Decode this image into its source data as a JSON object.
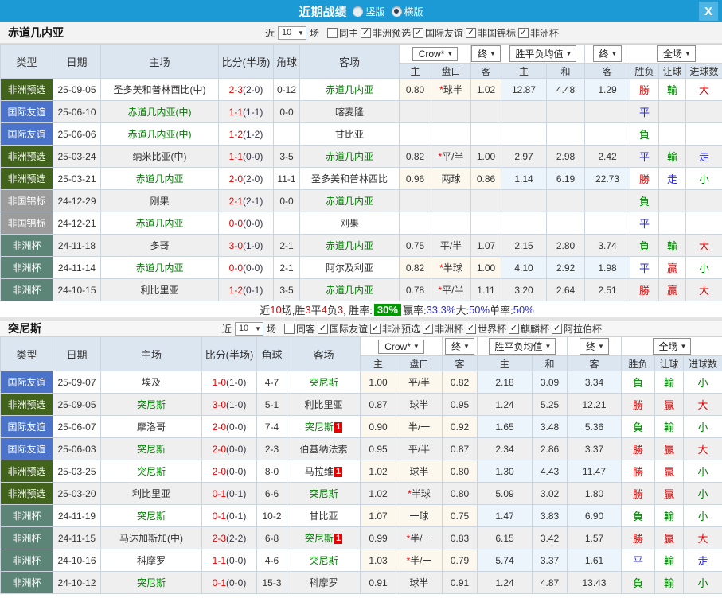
{
  "titlebar": {
    "title": "近期战绩",
    "vertical": "竖版",
    "horizontal": "横版",
    "close": "X"
  },
  "type_colors": {
    "非洲预选": "#41631c",
    "国际友谊": "#4b73c9",
    "非国锦标": "#9c9c9c",
    "非洲杯": "#5c8477"
  },
  "result_colors": {
    "勝": "#e60000",
    "平": "#2b2bd5",
    "負": "#008000",
    "贏": "#e60000",
    "走": "#2b2bd5",
    "輸": "#008000",
    "大": "#e60000",
    "小": "#008000"
  },
  "sections": [
    {
      "team": "赤道几内亚",
      "filter": {
        "near": "近",
        "count": "10",
        "unit": "场",
        "checkboxes": [
          {
            "label": "同主",
            "checked": false
          },
          {
            "label": "非洲预选",
            "checked": true
          },
          {
            "label": "国际友谊",
            "checked": true
          },
          {
            "label": "非国锦标",
            "checked": true
          },
          {
            "label": "非洲杯",
            "checked": true
          }
        ]
      },
      "header": {
        "type": "类型",
        "date": "日期",
        "home": "主场",
        "score": "比分(半场)",
        "corner": "角球",
        "away": "客场",
        "odds_company": "Crow*",
        "final1": "终",
        "mean": "胜平负均值",
        "final2": "终",
        "scope": "全场",
        "odds_sub": [
          "主",
          "盘口",
          "客"
        ],
        "mean_sub": [
          "主",
          "和",
          "客"
        ],
        "result_sub": [
          "胜负",
          "让球",
          "进球数"
        ]
      },
      "rows": [
        {
          "type": "非洲预选",
          "date": "25-09-05",
          "home": "圣多美和普林西比(中)",
          "home_team": false,
          "home_badge": "",
          "score_ft": "2-3",
          "score_ht": "(2-0)",
          "corner": "0-12",
          "away": "赤道几内亚",
          "away_team": true,
          "away_badge": "",
          "odds": [
            "0.80",
            "*球半",
            "1.02"
          ],
          "mean": [
            "12.87",
            "4.48",
            "1.29"
          ],
          "results": [
            "勝",
            "輸",
            "大"
          ]
        },
        {
          "type": "国际友谊",
          "date": "25-06-10",
          "home": "赤道几内亚(中)",
          "home_team": true,
          "home_badge": "",
          "score_ft": "1-1",
          "score_ht": "(1-1)",
          "corner": "0-0",
          "away": "喀麦隆",
          "away_team": false,
          "away_badge": "",
          "odds": [
            "",
            "",
            ""
          ],
          "mean": [
            "",
            "",
            ""
          ],
          "results": [
            "平",
            "",
            ""
          ]
        },
        {
          "type": "国际友谊",
          "date": "25-06-06",
          "home": "赤道几内亚(中)",
          "home_team": true,
          "home_badge": "",
          "score_ft": "1-2",
          "score_ht": "(1-2)",
          "corner": "",
          "away": "甘比亚",
          "away_team": false,
          "away_badge": "",
          "odds": [
            "",
            "",
            ""
          ],
          "mean": [
            "",
            "",
            ""
          ],
          "results": [
            "負",
            "",
            ""
          ]
        },
        {
          "type": "非洲预选",
          "date": "25-03-24",
          "home": "纳米比亚(中)",
          "home_team": false,
          "home_badge": "",
          "score_ft": "1-1",
          "score_ht": "(0-0)",
          "corner": "3-5",
          "away": "赤道几内亚",
          "away_team": true,
          "away_badge": "",
          "odds": [
            "0.82",
            "*平/半",
            "1.00"
          ],
          "mean": [
            "2.97",
            "2.98",
            "2.42"
          ],
          "results": [
            "平",
            "輸",
            "走"
          ]
        },
        {
          "type": "非洲预选",
          "date": "25-03-21",
          "home": "赤道几内亚",
          "home_team": true,
          "home_badge": "",
          "score_ft": "2-0",
          "score_ht": "(2-0)",
          "corner": "11-1",
          "away": "圣多美和普林西比",
          "away_team": false,
          "away_badge": "",
          "odds": [
            "0.96",
            "两球",
            "0.86"
          ],
          "mean": [
            "1.14",
            "6.19",
            "22.73"
          ],
          "results": [
            "勝",
            "走",
            "小"
          ]
        },
        {
          "type": "非国锦标",
          "date": "24-12-29",
          "home": "刚果",
          "home_team": false,
          "home_badge": "",
          "score_ft": "2-1",
          "score_ht": "(2-1)",
          "corner": "0-0",
          "away": "赤道几内亚",
          "away_team": true,
          "away_badge": "",
          "odds": [
            "",
            "",
            ""
          ],
          "mean": [
            "",
            "",
            ""
          ],
          "results": [
            "負",
            "",
            ""
          ]
        },
        {
          "type": "非国锦标",
          "date": "24-12-21",
          "home": "赤道几内亚",
          "home_team": true,
          "home_badge": "",
          "score_ft": "0-0",
          "score_ht": "(0-0)",
          "corner": "",
          "away": "刚果",
          "away_team": false,
          "away_badge": "",
          "odds": [
            "",
            "",
            ""
          ],
          "mean": [
            "",
            "",
            ""
          ],
          "results": [
            "平",
            "",
            ""
          ]
        },
        {
          "type": "非洲杯",
          "date": "24-11-18",
          "home": "多哥",
          "home_team": false,
          "home_badge": "",
          "score_ft": "3-0",
          "score_ht": "(1-0)",
          "corner": "2-1",
          "away": "赤道几内亚",
          "away_team": true,
          "away_badge": "",
          "odds": [
            "0.75",
            "平/半",
            "1.07"
          ],
          "mean": [
            "2.15",
            "2.80",
            "3.74"
          ],
          "results": [
            "負",
            "輸",
            "大"
          ]
        },
        {
          "type": "非洲杯",
          "date": "24-11-14",
          "home": "赤道几内亚",
          "home_team": true,
          "home_badge": "",
          "score_ft": "0-0",
          "score_ht": "(0-0)",
          "corner": "2-1",
          "away": "阿尔及利亚",
          "away_team": false,
          "away_badge": "",
          "odds": [
            "0.82",
            "*半球",
            "1.00"
          ],
          "mean": [
            "4.10",
            "2.92",
            "1.98"
          ],
          "results": [
            "平",
            "贏",
            "小"
          ]
        },
        {
          "type": "非洲杯",
          "date": "24-10-15",
          "home": "利比里亚",
          "home_team": false,
          "home_badge": "",
          "score_ft": "1-2",
          "score_ht": "(0-1)",
          "corner": "3-5",
          "away": "赤道几内亚",
          "away_team": true,
          "away_badge": "",
          "odds": [
            "0.78",
            "*平/半",
            "1.11"
          ],
          "mean": [
            "3.20",
            "2.64",
            "2.51"
          ],
          "results": [
            "勝",
            "贏",
            "大"
          ]
        }
      ],
      "summary": {
        "segments": [
          {
            "text": "近"
          },
          {
            "text": "10",
            "color": "red"
          },
          {
            "text": "场,胜"
          },
          {
            "text": "3",
            "color": "red"
          },
          {
            "text": "平"
          },
          {
            "text": "4",
            "color": "red"
          },
          {
            "text": "负"
          },
          {
            "text": "3",
            "color": "red"
          },
          {
            "text": ", 胜率:"
          },
          {
            "text": "30%",
            "style": "badge"
          },
          {
            "text": " 赢率:"
          },
          {
            "text": "33.3%",
            "color": "blue"
          },
          {
            "text": " 大:"
          },
          {
            "text": "50%",
            "color": "blue"
          },
          {
            "text": " 单率:"
          },
          {
            "text": "50%",
            "color": "blue"
          }
        ]
      }
    },
    {
      "team": "突尼斯",
      "filter": {
        "near": "近",
        "count": "10",
        "unit": "场",
        "checkboxes": [
          {
            "label": "同客",
            "checked": false
          },
          {
            "label": "国际友谊",
            "checked": true
          },
          {
            "label": "非洲预选",
            "checked": true
          },
          {
            "label": "非洲杯",
            "checked": true
          },
          {
            "label": "世界杯",
            "checked": true
          },
          {
            "label": "麒麟杯",
            "checked": true
          },
          {
            "label": "阿拉伯杯",
            "checked": true
          }
        ]
      },
      "header": {
        "type": "类型",
        "date": "日期",
        "home": "主场",
        "score": "比分(半场)",
        "corner": "角球",
        "away": "客场",
        "odds_company": "Crow*",
        "final1": "终",
        "mean": "胜平负均值",
        "final2": "终",
        "scope": "全场",
        "odds_sub": [
          "主",
          "盘口",
          "客"
        ],
        "mean_sub": [
          "主",
          "和",
          "客"
        ],
        "result_sub": [
          "胜负",
          "让球",
          "进球数"
        ]
      },
      "rows": [
        {
          "type": "国际友谊",
          "date": "25-09-07",
          "home": "埃及",
          "home_team": false,
          "home_badge": "",
          "score_ft": "1-0",
          "score_ht": "(1-0)",
          "corner": "4-7",
          "away": "突尼斯",
          "away_team": true,
          "away_badge": "",
          "odds": [
            "1.00",
            "平/半",
            "0.82"
          ],
          "mean": [
            "2.18",
            "3.09",
            "3.34"
          ],
          "results": [
            "負",
            "輸",
            "小"
          ]
        },
        {
          "type": "非洲预选",
          "date": "25-09-05",
          "home": "突尼斯",
          "home_team": true,
          "home_badge": "",
          "score_ft": "3-0",
          "score_ht": "(1-0)",
          "corner": "5-1",
          "away": "利比里亚",
          "away_team": false,
          "away_badge": "",
          "odds": [
            "0.87",
            "球半",
            "0.95"
          ],
          "mean": [
            "1.24",
            "5.25",
            "12.21"
          ],
          "results": [
            "勝",
            "贏",
            "大"
          ]
        },
        {
          "type": "国际友谊",
          "date": "25-06-07",
          "home": "摩洛哥",
          "home_team": false,
          "home_badge": "",
          "score_ft": "2-0",
          "score_ht": "(0-0)",
          "corner": "7-4",
          "away": "突尼斯",
          "away_team": true,
          "away_badge": "1",
          "odds": [
            "0.90",
            "半/一",
            "0.92"
          ],
          "mean": [
            "1.65",
            "3.48",
            "5.36"
          ],
          "results": [
            "負",
            "輸",
            "小"
          ]
        },
        {
          "type": "国际友谊",
          "date": "25-06-03",
          "home": "突尼斯",
          "home_team": true,
          "home_badge": "",
          "score_ft": "2-0",
          "score_ht": "(0-0)",
          "corner": "2-3",
          "away": "伯基纳法索",
          "away_team": false,
          "away_badge": "",
          "odds": [
            "0.95",
            "平/半",
            "0.87"
          ],
          "mean": [
            "2.34",
            "2.86",
            "3.37"
          ],
          "results": [
            "勝",
            "贏",
            "大"
          ]
        },
        {
          "type": "非洲预选",
          "date": "25-03-25",
          "home": "突尼斯",
          "home_team": true,
          "home_badge": "",
          "score_ft": "2-0",
          "score_ht": "(0-0)",
          "corner": "8-0",
          "away": "马拉维",
          "away_team": false,
          "away_badge": "1",
          "odds": [
            "1.02",
            "球半",
            "0.80"
          ],
          "mean": [
            "1.30",
            "4.43",
            "11.47"
          ],
          "results": [
            "勝",
            "贏",
            "小"
          ]
        },
        {
          "type": "非洲预选",
          "date": "25-03-20",
          "home": "利比里亚",
          "home_team": false,
          "home_badge": "",
          "score_ft": "0-1",
          "score_ht": "(0-1)",
          "corner": "6-6",
          "away": "突尼斯",
          "away_team": true,
          "away_badge": "",
          "odds": [
            "1.02",
            "*半球",
            "0.80"
          ],
          "mean": [
            "5.09",
            "3.02",
            "1.80"
          ],
          "results": [
            "勝",
            "贏",
            "小"
          ]
        },
        {
          "type": "非洲杯",
          "date": "24-11-19",
          "home": "突尼斯",
          "home_team": true,
          "home_badge": "",
          "score_ft": "0-1",
          "score_ht": "(0-1)",
          "corner": "10-2",
          "away": "甘比亚",
          "away_team": false,
          "away_badge": "",
          "odds": [
            "1.07",
            "一球",
            "0.75"
          ],
          "mean": [
            "1.47",
            "3.83",
            "6.90"
          ],
          "results": [
            "負",
            "輸",
            "小"
          ]
        },
        {
          "type": "非洲杯",
          "date": "24-11-15",
          "home": "马达加斯加(中)",
          "home_team": false,
          "home_badge": "",
          "score_ft": "2-3",
          "score_ht": "(2-2)",
          "corner": "6-8",
          "away": "突尼斯",
          "away_team": true,
          "away_badge": "1",
          "odds": [
            "0.99",
            "*半/一",
            "0.83"
          ],
          "mean": [
            "6.15",
            "3.42",
            "1.57"
          ],
          "results": [
            "勝",
            "贏",
            "大"
          ]
        },
        {
          "type": "非洲杯",
          "date": "24-10-16",
          "home": "科摩罗",
          "home_team": false,
          "home_badge": "",
          "score_ft": "1-1",
          "score_ht": "(0-0)",
          "corner": "4-6",
          "away": "突尼斯",
          "away_team": true,
          "away_badge": "",
          "odds": [
            "1.03",
            "*半/一",
            "0.79"
          ],
          "mean": [
            "5.74",
            "3.37",
            "1.61"
          ],
          "results": [
            "平",
            "輸",
            "走"
          ]
        },
        {
          "type": "非洲杯",
          "date": "24-10-12",
          "home": "突尼斯",
          "home_team": true,
          "home_badge": "",
          "score_ft": "0-1",
          "score_ht": "(0-0)",
          "corner": "15-3",
          "away": "科摩罗",
          "away_team": false,
          "away_badge": "",
          "odds": [
            "0.91",
            "球半",
            "0.91"
          ],
          "mean": [
            "1.24",
            "4.87",
            "13.43"
          ],
          "results": [
            "負",
            "輸",
            "小"
          ]
        }
      ]
    }
  ]
}
